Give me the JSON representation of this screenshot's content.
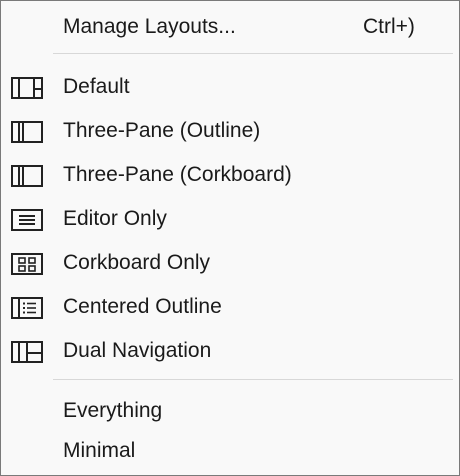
{
  "menu": {
    "manage": {
      "label": "Manage Layouts...",
      "shortcut": "Ctrl+)"
    },
    "layouts": [
      {
        "label": "Default",
        "icon": "layout-default-icon"
      },
      {
        "label": "Three-Pane (Outline)",
        "icon": "layout-three-pane-outline-icon"
      },
      {
        "label": "Three-Pane (Corkboard)",
        "icon": "layout-three-pane-corkboard-icon"
      },
      {
        "label": "Editor Only",
        "icon": "layout-editor-only-icon"
      },
      {
        "label": "Corkboard Only",
        "icon": "layout-corkboard-only-icon"
      },
      {
        "label": "Centered Outline",
        "icon": "layout-centered-outline-icon"
      },
      {
        "label": "Dual Navigation",
        "icon": "layout-dual-navigation-icon"
      }
    ],
    "extras": [
      {
        "label": "Everything"
      },
      {
        "label": "Minimal"
      }
    ]
  },
  "colors": {
    "background": "#f9f9f9",
    "border": "#7a7a7a",
    "text": "#1a1a1a",
    "separator": "#d8d8d8",
    "icon_stroke": "#222222"
  }
}
